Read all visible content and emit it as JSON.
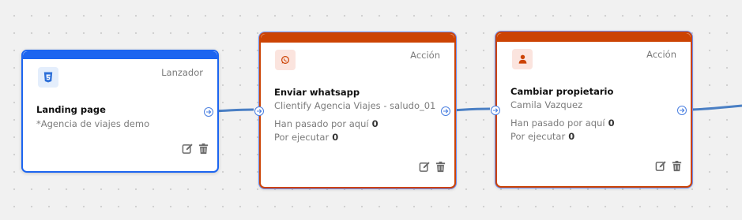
{
  "nodes": [
    {
      "type_label": "Lanzador",
      "icon": "html5-icon",
      "title": "Landing page",
      "subtitle": "*Agencia de viajes demo",
      "accent": "#1c65f0"
    },
    {
      "type_label": "Acción",
      "icon": "whatsapp-icon",
      "title": "Enviar whatsapp",
      "subtitle": "Clientify Agencia Viajes - saludo_01",
      "stat_visited_label": "Han pasado por aquí",
      "stat_visited_value": "0",
      "stat_pending_label": "Por ejecutar",
      "stat_pending_value": "0",
      "accent": "#cc4304"
    },
    {
      "type_label": "Acción",
      "icon": "user-icon",
      "title": "Cambiar propietario",
      "subtitle": "Camila Vazquez",
      "stat_visited_label": "Han pasado por aquí",
      "stat_visited_value": "0",
      "stat_pending_label": "Por ejecutar",
      "stat_pending_value": "0",
      "accent": "#cc4304"
    }
  ],
  "colors": {
    "edge": "#4a7fc4",
    "port_border": "#4a7fe0",
    "icon_gray": "#6b6b6b"
  }
}
